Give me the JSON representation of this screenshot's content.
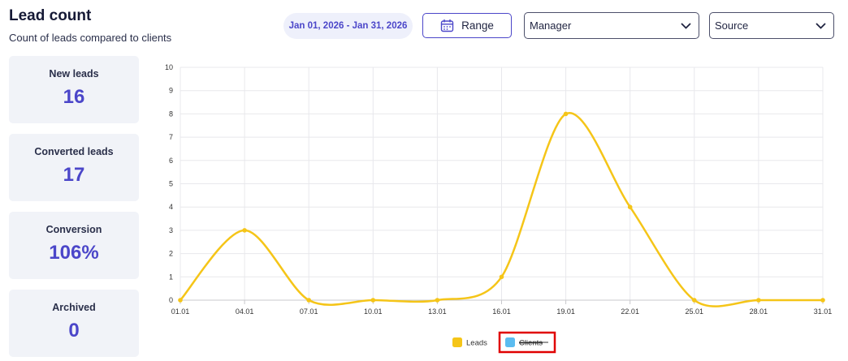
{
  "header": {
    "title": "Lead count",
    "subtitle": "Count of leads compared to clients"
  },
  "filters": {
    "date_range": "Jan 01, 2026 - Jan 31, 2026",
    "range_label": "Range",
    "manager_value": "Manager",
    "source_value": "Source"
  },
  "stats": [
    {
      "label": "New leads",
      "value": "16"
    },
    {
      "label": "Converted leads",
      "value": "17"
    },
    {
      "label": "Conversion",
      "value": "106%"
    },
    {
      "label": "Archived",
      "value": "0"
    }
  ],
  "colors": {
    "accent": "#4b46c9",
    "leads": "#f5c518",
    "clients": "#5bbcf0",
    "highlight": "#e00000"
  },
  "chart_data": {
    "type": "line",
    "x": [
      "01.01",
      "04.01",
      "07.01",
      "10.01",
      "13.01",
      "16.01",
      "19.01",
      "22.01",
      "25.01",
      "28.01",
      "31.01"
    ],
    "ylim": [
      0,
      10
    ],
    "yticks": [
      0,
      1,
      2,
      3,
      4,
      5,
      6,
      7,
      8,
      9,
      10
    ],
    "grid": true,
    "legend_position": "bottom",
    "series": [
      {
        "name": "Leads",
        "values": [
          0,
          3,
          0,
          0,
          0,
          1,
          8,
          4,
          0,
          0,
          0
        ],
        "visible": true
      },
      {
        "name": "Clients",
        "values": [],
        "visible": false
      }
    ]
  }
}
